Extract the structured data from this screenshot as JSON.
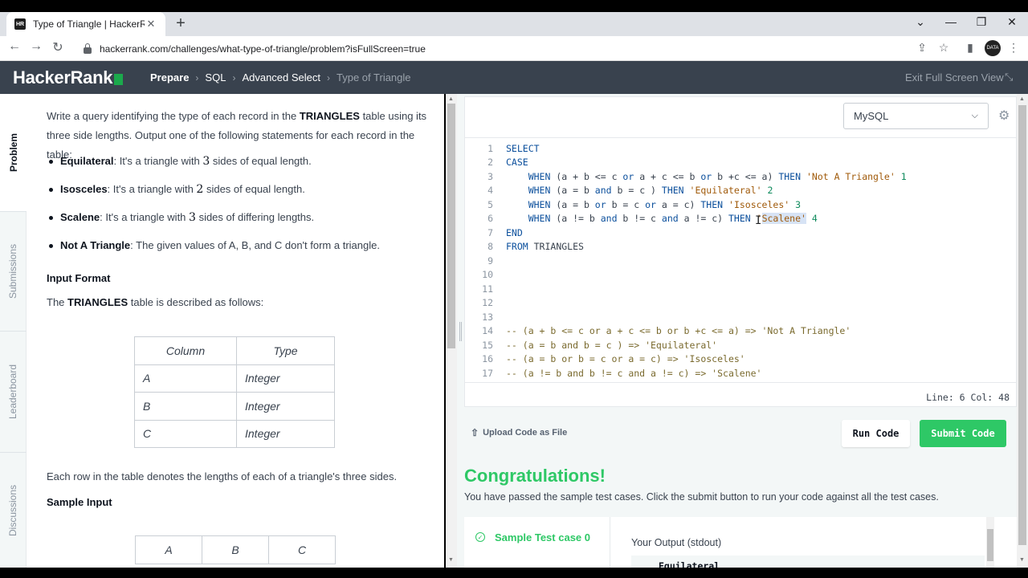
{
  "browser": {
    "tab_title": "Type of Triangle | HackerRank",
    "tab_favicon": "HR",
    "url_host": "hackerrank.com",
    "url_path": "/challenges/what-type-of-triangle/problem?isFullScreen=true",
    "profile_text": "DATA"
  },
  "header": {
    "logo": "HackerRank",
    "breadcrumbs": [
      "Prepare",
      "SQL",
      "Advanced Select",
      "Type of Triangle"
    ],
    "exit_fullscreen": "Exit Full Screen View"
  },
  "side_tabs": [
    "Problem",
    "Submissions",
    "Leaderboard",
    "Discussions"
  ],
  "problem": {
    "intro_1": "Write a query identifying the type of each record in the ",
    "intro_table": "TRIANGLES",
    "intro_2": " table using its three side lengths. Output one of the following statements for each record in the table:",
    "bullets": [
      {
        "term": "Equilateral",
        "pre": ": It's a triangle with ",
        "num": "3",
        "post": " sides of equal length."
      },
      {
        "term": "Isosceles",
        "pre": ": It's a triangle with ",
        "num": "2",
        "post": " sides of equal length."
      },
      {
        "term": "Scalene",
        "pre": ": It's a triangle with ",
        "num": "3",
        "post": " sides of differing lengths."
      },
      {
        "term": "Not A Triangle",
        "pre": ": The given values of A, B, and C don't form a triangle.",
        "num": "",
        "post": ""
      }
    ],
    "input_format_heading": "Input Format",
    "input_desc_1": "The ",
    "input_desc_table": "TRIANGLES",
    "input_desc_2": " table is described as follows:",
    "schema_headers": [
      "Column",
      "Type"
    ],
    "schema_rows": [
      [
        "A",
        "Integer"
      ],
      [
        "B",
        "Integer"
      ],
      [
        "C",
        "Integer"
      ]
    ],
    "row_desc": "Each row in the table denotes the lengths of each of a triangle's three sides.",
    "sample_input_heading": "Sample Input",
    "sample_headers": [
      "A",
      "B",
      "C"
    ]
  },
  "editor": {
    "language": "MySQL",
    "cursor_status": "Line: 6 Col: 48",
    "lines": [
      "SELECT",
      "CASE",
      "    WHEN (a + b <= c or a + c <= b or b +c <= a) THEN 'Not A Triangle' 1",
      "    WHEN (a = b and b = c ) THEN 'Equilateral' 2",
      "    WHEN (a = b or b = c or a = c) THEN 'Isosceles' 3",
      "    WHEN (a != b and b != c and a != c) THEN 'Scalene' 4",
      "END",
      "FROM TRIANGLES",
      "",
      "",
      "",
      "",
      "",
      "-- (a + b <= c or a + c <= b or b +c <= a) => 'Not A Triangle'",
      "-- (a = b and b = c ) => 'Equilateral'",
      "-- (a = b or b = c or a = c) => 'Isosceles'",
      "-- (a != b and b != c and a != c) => 'Scalene'"
    ]
  },
  "actions": {
    "upload": "Upload Code as File",
    "run": "Run Code",
    "submit": "Submit Code"
  },
  "result": {
    "title": "Congratulations!",
    "message": "You have passed the sample test cases. Click the submit button to run your code against all the test cases.",
    "testcase": "Sample Test case 0",
    "output_label": "Your Output (stdout)",
    "output_first": "Equilateral"
  },
  "colors": {
    "accent_green": "#2ec866",
    "header_bg": "#39424e",
    "logo_green": "#1ba94c"
  }
}
